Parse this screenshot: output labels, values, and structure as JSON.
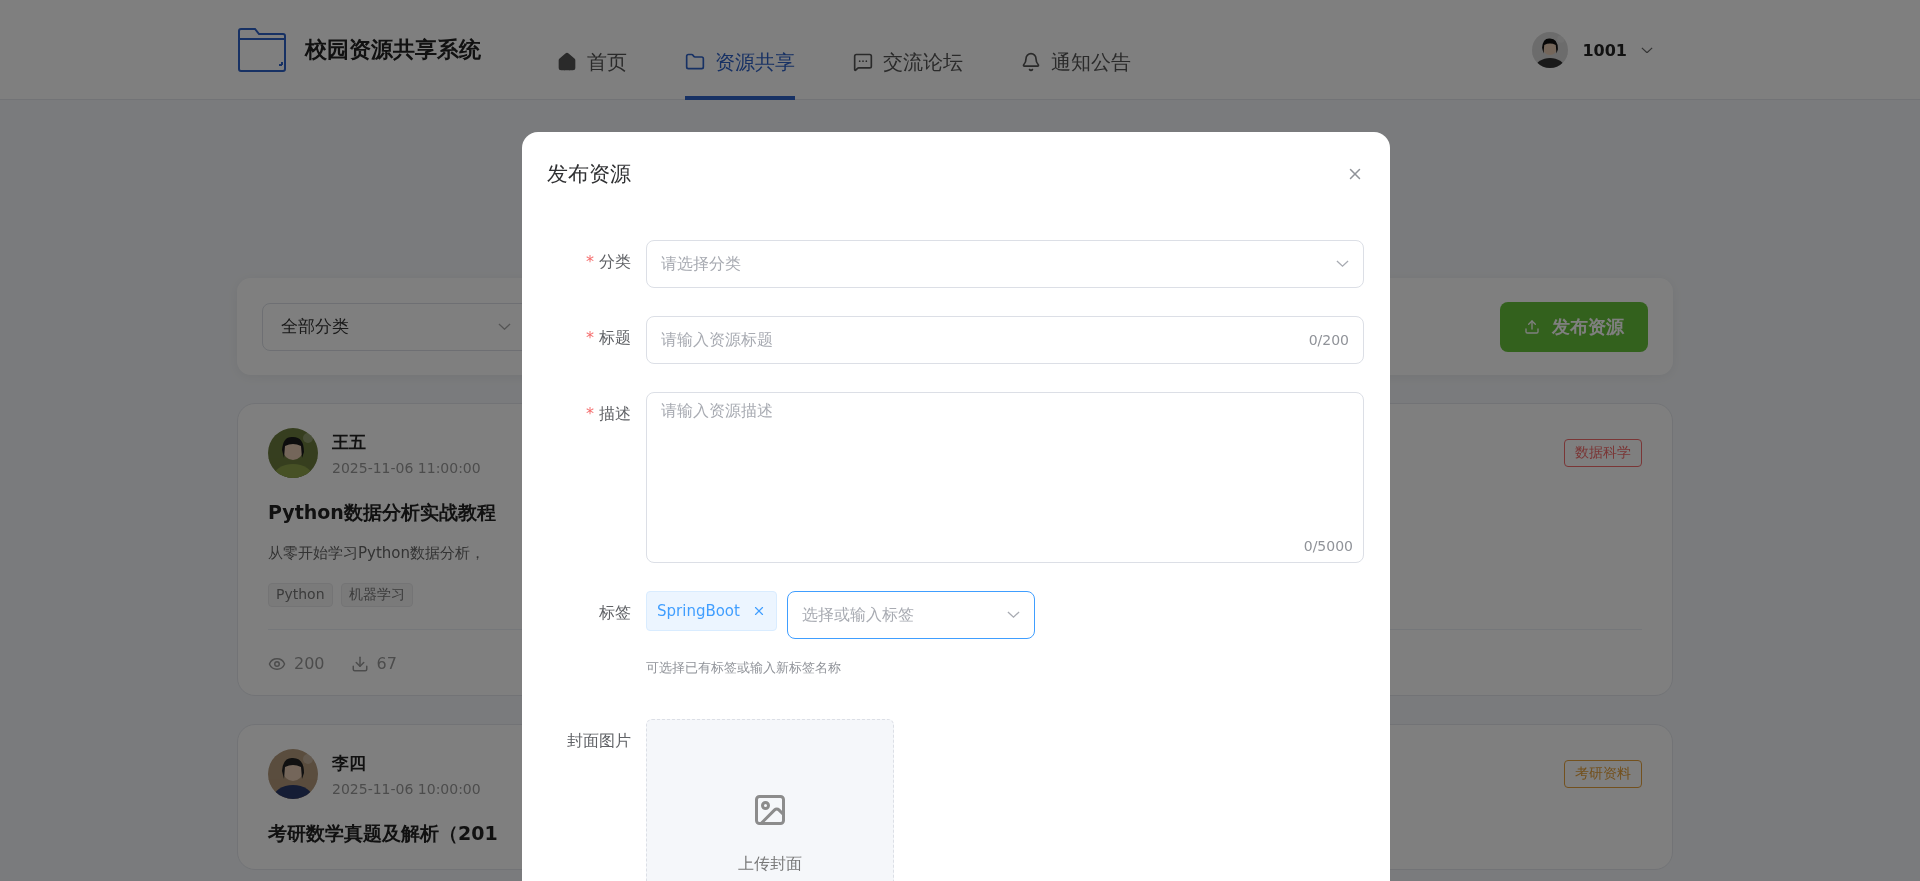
{
  "header": {
    "brand": "校园资源共享系统",
    "nav": [
      {
        "label": "首页",
        "selected": false
      },
      {
        "label": "资源共享",
        "selected": true
      },
      {
        "label": "交流论坛",
        "selected": false
      },
      {
        "label": "通知公告",
        "selected": false
      }
    ],
    "user": {
      "name": "1001"
    }
  },
  "toolbar": {
    "category_select": {
      "value": "全部分类"
    },
    "publish_button": "发布资源"
  },
  "resources": [
    {
      "author": "王五",
      "time": "2025-11-06 11:00:00",
      "title": "Python数据分析实战教程",
      "description": "从零开始学习Python数据分析，",
      "tags": [
        "Python",
        "机器学习"
      ],
      "category": {
        "label": "数据科学",
        "color": "#7a3636"
      },
      "views": "200",
      "downloads": "67"
    },
    {
      "author": "李四",
      "time": "2025-11-06 10:00:00",
      "title": "考研数学真题及解析（201",
      "category": {
        "label": "考研资料",
        "color": "#73511e"
      }
    }
  ],
  "dialog": {
    "title": "发布资源",
    "fields": [
      {
        "kind": "select",
        "label": "分类",
        "required_mark": "*",
        "placeholder": "请选择分类"
      },
      {
        "kind": "input",
        "label": "标题",
        "required_mark": "*",
        "placeholder": "请输入资源标题",
        "counter": "0/200"
      },
      {
        "kind": "textarea",
        "label": "描述",
        "required_mark": "*",
        "placeholder": "请输入资源描述",
        "counter": "0/5000"
      },
      {
        "kind": "tags",
        "label": "标签",
        "tags": [
          "SpringBoot"
        ],
        "placeholder": "选择或输入标签",
        "focused": true,
        "hint": "可选择已有标签或输入新标签名称"
      },
      {
        "kind": "upload",
        "label": "封面图片",
        "text": "上传封面"
      }
    ]
  }
}
